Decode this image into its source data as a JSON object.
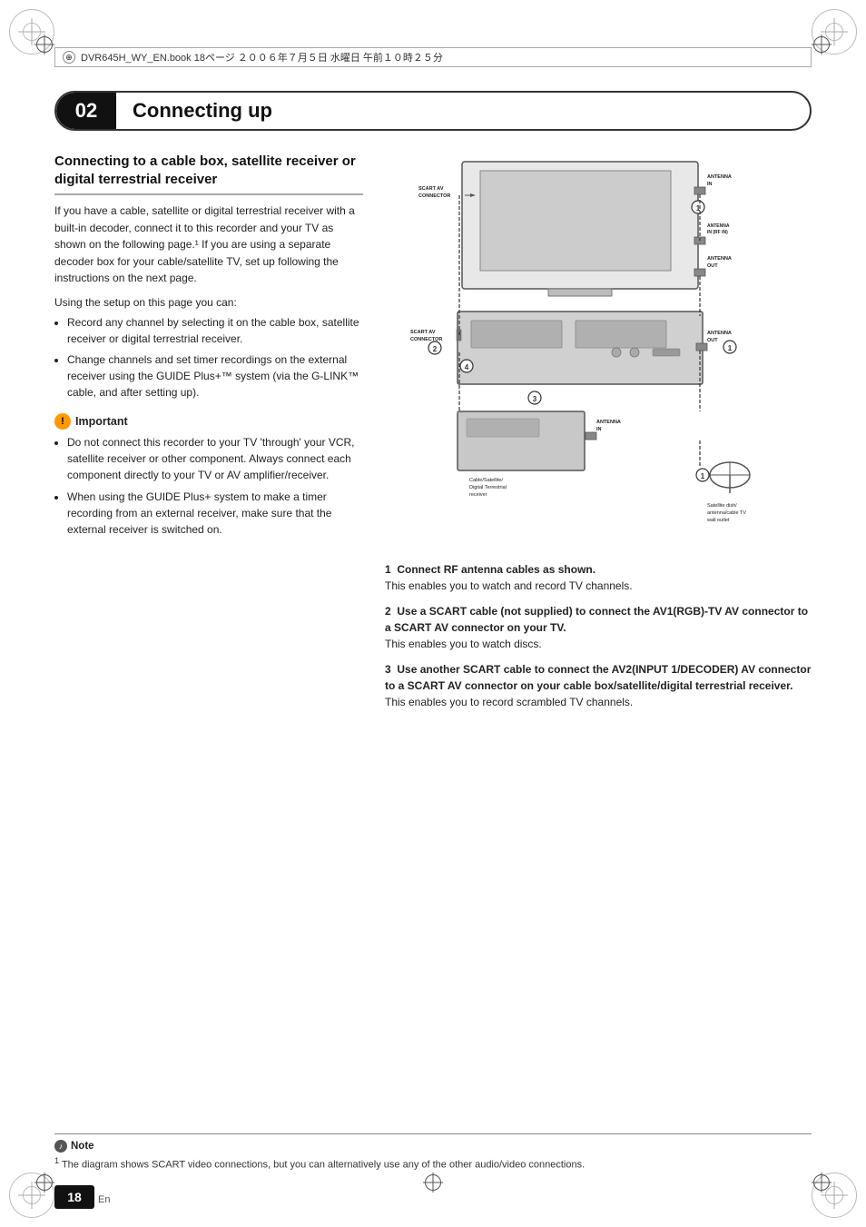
{
  "page": {
    "file_info": "DVR645H_WY_EN.book  18ページ  ２００６年７月５日  水曜日  午前１０時２５分",
    "chapter_number": "02",
    "chapter_title": "Connecting up",
    "page_number": "18",
    "page_lang": "En"
  },
  "section": {
    "title": "Connecting to a cable box, satellite receiver or digital terrestrial receiver",
    "intro": "If you have a cable, satellite or digital terrestrial receiver with a built-in decoder, connect it to this recorder and your TV as shown on the following page.¹ If you are using a separate decoder box for your cable/satellite TV, set up following the instructions on the next page.",
    "using_setup": "Using the setup on this page you can:",
    "bullets": [
      "Record any channel by selecting it on the cable box, satellite receiver or digital terrestrial receiver.",
      "Change channels and set timer recordings on the external receiver using the GUIDE Plus+™ system (via the G-LINK™ cable, and after setting up)."
    ]
  },
  "important": {
    "header": "Important",
    "bullets": [
      "Do not connect this recorder to your TV 'through' your VCR, satellite receiver or other component. Always connect each component directly to your TV or AV amplifier/receiver.",
      "When using the GUIDE Plus+ system to make a timer recording from an external receiver, make sure that the external receiver is switched on."
    ]
  },
  "instructions": [
    {
      "number": "1",
      "bold": "Connect RF antenna cables as shown.",
      "text": "This enables you to watch and record TV channels."
    },
    {
      "number": "2",
      "bold": "Use a SCART cable (not supplied) to connect the AV1(RGB)-TV AV connector to a SCART AV connector on your TV.",
      "text": "This enables you to watch discs."
    },
    {
      "number": "3",
      "bold": "Use another SCART cable to connect the AV2(INPUT 1/DECODER) AV connector to a SCART AV connector on your cable box/satellite/digital terrestrial receiver.",
      "text": "This enables you to record scrambled TV channels."
    }
  ],
  "note": {
    "header": "Note",
    "superscript": "1",
    "text": "The diagram shows SCART video connections, but you can alternatively use any of the other audio/video connections."
  },
  "diagram": {
    "labels": {
      "scart_av_connector_top": "SCART AV CONNECTOR",
      "antenna_in": "ANTENNA IN",
      "antenna_in_rf": "ANTENNA IN (RF IN)",
      "antenna_out": "ANTENNA OUT",
      "scart_av_connector_bottom": "SCART AV CONNECTOR",
      "antenna_out2": "ANTENNA OUT",
      "antenna_in2": "ANTENNA IN",
      "cable_satellite": "Cable/Satellite/ Digital Terrestrial receiver",
      "satellite_dish": "Satellite dish/ antenna/cable TV wall outlet"
    },
    "callouts": [
      "1",
      "2",
      "3",
      "4",
      "1",
      "2"
    ]
  }
}
